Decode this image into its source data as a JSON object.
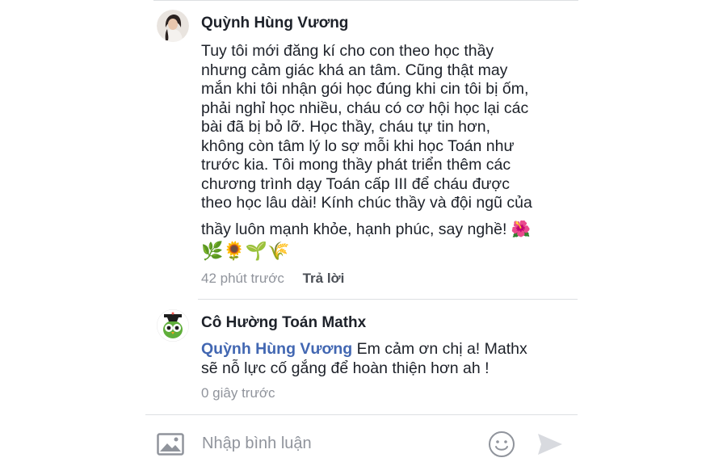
{
  "comments": [
    {
      "author": "Quỳnh Hùng Vương",
      "text_lines": [
        "Tuy tôi mới đăng kí cho con theo học thầy",
        "nhưng cảm giác khá an tâm. Cũng thật may",
        "mắn khi tôi nhận gói học đúng khi cin tôi bị ốm,",
        "phải nghỉ học nhiều, cháu có cơ hội học lại các",
        "bài đã bị bỏ lỡ. Học thầy, cháu tự tin hơn,",
        "không còn tâm lý lo sợ mỗi khi học Toán như",
        "trước kia. Tôi mong thầy phát triển thêm các",
        "chương trình dạy Toán cấp III để cháu được",
        "theo học lâu dài! Kính chúc thầy và đội ngũ của"
      ],
      "last_line": "thầy luôn mạnh khỏe, hạnh phúc, say nghề! 🌺",
      "emoji_line": "🌿🌻🌱🌾",
      "time": "42 phút trước",
      "reply_label": "Trả lời"
    },
    {
      "author": "Cô Hường Toán Mathx",
      "mention": "Quỳnh Hùng Vương",
      "text_line_1": " Em cảm ơn chị a! Mathx",
      "text_line_2": "sẽ nỗ lực cố gắng để hoàn thiện hơn ah !",
      "time": "0 giây trước"
    }
  ],
  "composer": {
    "placeholder": "Nhập bình luận"
  },
  "icons": {
    "photo": "photo-icon",
    "emoji": "smiley-icon",
    "send": "send-icon"
  },
  "colors": {
    "mention": "#4267b2",
    "meta": "#90949c",
    "divider": "#dddfe2"
  }
}
